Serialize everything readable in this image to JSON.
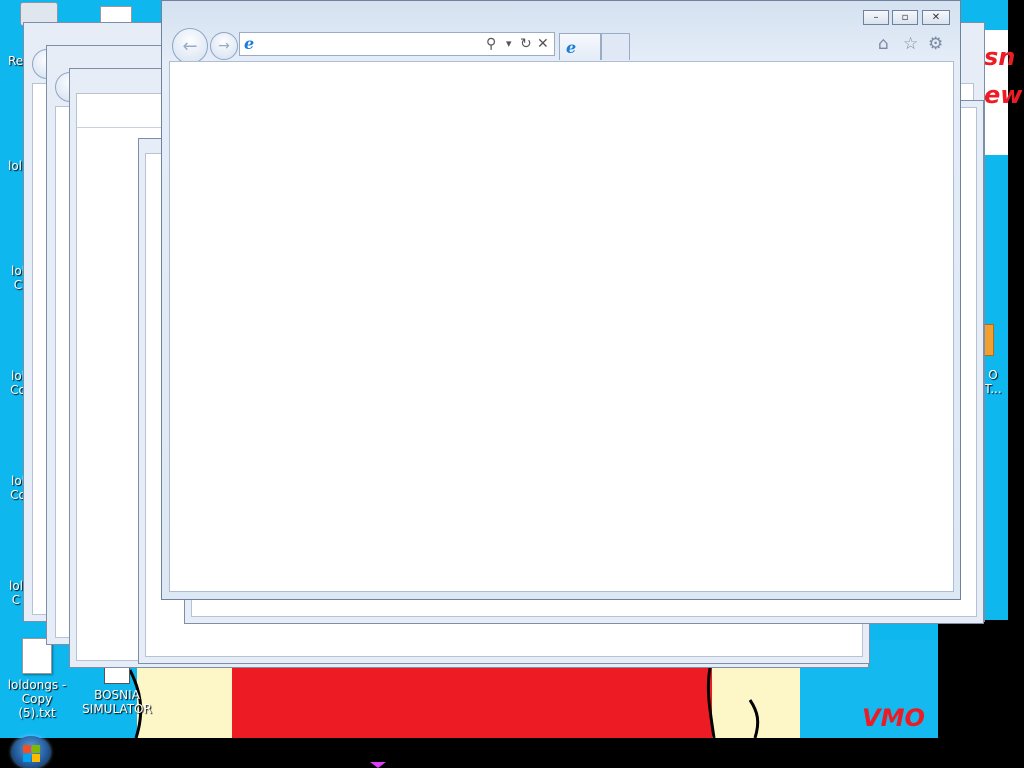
{
  "desktop": {
    "icons": [
      {
        "label": "Re"
      },
      {
        "label": "lol"
      },
      {
        "label": "lol C"
      },
      {
        "label": "lol Co"
      },
      {
        "label": "lol Co"
      },
      {
        "label": "lol C"
      },
      {
        "label": "loldongs - Copy (5).txt"
      },
      {
        "label": "BOSNIA SIMULATOR"
      }
    ],
    "right_fragments": [
      "O",
      "T..."
    ],
    "wallpaper_text": {
      "top_right": [
        "sn",
        "ew"
      ],
      "bottom": "VMO"
    },
    "colors": {
      "background": "#0fb7ef",
      "red": "#ed1c24",
      "cream": "#fdf7c7"
    }
  },
  "ie_window": {
    "caption": {
      "minimize": "–",
      "restore": "▫",
      "close": "✕"
    },
    "address_bar": {
      "value": "",
      "ie_icon": "ie-logo-icon"
    },
    "addr_tools": {
      "search": "⚲",
      "dropdown": "▾",
      "refresh": "↻",
      "stop": "✕"
    },
    "tab_icon": "e",
    "toolbar_icons": {
      "home": "⌂",
      "favorites": "☆",
      "tools": "⚙"
    }
  },
  "taskbar": {
    "start": "start-orb-icon"
  }
}
